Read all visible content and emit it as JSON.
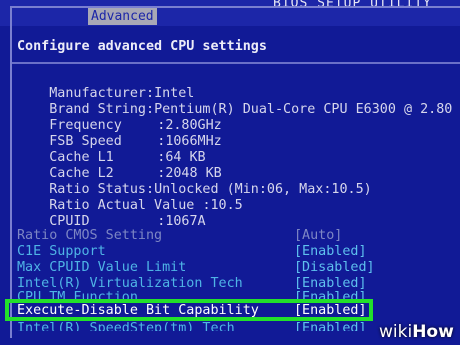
{
  "header": {
    "bios_title": "BIOS SETUP UTILITY",
    "active_tab": "Advanced"
  },
  "panel": {
    "heading": "Configure advanced CPU settings"
  },
  "cpu_info": [
    {
      "key": "Manufacturer",
      "sep": ":",
      "value": "Intel"
    },
    {
      "key": "Brand String",
      "sep": ":",
      "value": "Pentium(R) Dual-Core CPU E6300 @ 2.80"
    },
    {
      "key": "Frequency",
      "sep": ":",
      "value": "2.80GHz"
    },
    {
      "key": "FSB Speed",
      "sep": ":",
      "value": "1066MHz"
    },
    {
      "key": "Cache L1",
      "sep": ":",
      "value": "64 KB"
    },
    {
      "key": "Cache L2",
      "sep": ":",
      "value": "2048 KB"
    },
    {
      "key": "Ratio Status",
      "sep": ":",
      "value": "Unlocked (Min:06, Max:10.5)"
    },
    {
      "key": "Ratio Actual Value",
      "sep": ":",
      "value": "10.5"
    },
    {
      "key": "CPUID",
      "sep": ":",
      "value": "1067A"
    }
  ],
  "settings": [
    {
      "label": "Ratio CMOS Setting",
      "value": "[Auto]"
    },
    {
      "label": "C1E Support",
      "value": "[Enabled]"
    },
    {
      "label": "Max CPUID Value Limit",
      "value": "[Disabled]"
    },
    {
      "label": "Intel(R) Virtualization Tech",
      "value": "[Enabled]"
    },
    {
      "label": "CPU TM Function",
      "value": "[Enabled]"
    },
    {
      "label": "Execute-Disable Bit Capability",
      "value": "[Enabled]"
    },
    {
      "label": "Intel(R) SpeedStep(tm) Tech",
      "value": "[Enabled]"
    }
  ],
  "watermark": {
    "part1": "wiki",
    "part2": "How"
  },
  "colors": {
    "bios_blue": "#111a96",
    "highlight_green": "#22e02a",
    "option_cyan": "#4fb4e6"
  }
}
